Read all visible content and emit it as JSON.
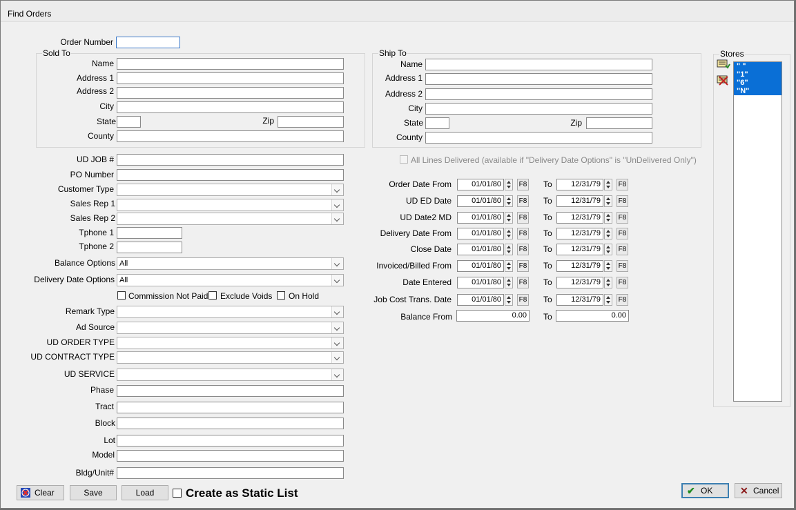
{
  "window": {
    "title": "Find Orders"
  },
  "order_number": {
    "label": "Order Number",
    "value": ""
  },
  "sold_to": {
    "title": "Sold To",
    "name_label": "Name",
    "address1_label": "Address 1",
    "address2_label": "Address 2",
    "city_label": "City",
    "state_label": "State",
    "zip_label": "Zip",
    "county_label": "County"
  },
  "ship_to": {
    "title": "Ship To",
    "name_label": "Name",
    "address1_label": "Address 1",
    "address2_label": "Address 2",
    "city_label": "City",
    "state_label": "State",
    "zip_label": "Zip",
    "county_label": "County"
  },
  "stores": {
    "title": "Stores",
    "items": [
      "\" \"",
      "\"1\"",
      "\"6\"",
      "\"N\""
    ]
  },
  "fields": {
    "ud_job": "UD JOB #",
    "po_number": "PO Number",
    "customer_type": "Customer Type",
    "sales_rep1": "Sales Rep 1",
    "sales_rep2": "Sales Rep 2",
    "tphone1": "Tphone 1",
    "tphone2": "Tphone 2",
    "balance_options": "Balance Options",
    "balance_options_value": "All",
    "delivery_date_options": "Delivery Date Options",
    "delivery_date_options_value": "All",
    "remark_type": "Remark Type",
    "ad_source": "Ad Source",
    "ud_order_type": "UD ORDER TYPE",
    "ud_contract_type": "UD CONTRACT TYPE",
    "ud_service": "UD SERVICE",
    "phase": "Phase",
    "tract": "Tract",
    "block": "Block",
    "lot": "Lot",
    "model": "Model",
    "bldg_unit": "Bldg/Unit#"
  },
  "checks": {
    "commission": "Commission Not Paid",
    "exclude_voids": "Exclude Voids",
    "on_hold": "On Hold"
  },
  "all_lines": "All Lines Delivered (available if \"Delivery Date Options\" is \"UnDelivered Only\")",
  "dates": {
    "to_label": "To",
    "f8": "F8",
    "rows": [
      {
        "label": "Order Date From",
        "from": "01/01/80",
        "to": "12/31/79"
      },
      {
        "label": "UD ED Date",
        "from": "01/01/80",
        "to": "12/31/79"
      },
      {
        "label": "UD Date2 MD",
        "from": "01/01/80",
        "to": "12/31/79"
      },
      {
        "label": "Delivery Date From",
        "from": "01/01/80",
        "to": "12/31/79"
      },
      {
        "label": "Close Date",
        "from": "01/01/80",
        "to": "12/31/79"
      },
      {
        "label": "Invoiced/Billed From",
        "from": "01/01/80",
        "to": "12/31/79"
      },
      {
        "label": "Date Entered",
        "from": "01/01/80",
        "to": "12/31/79"
      },
      {
        "label": "Job Cost Trans. Date",
        "from": "01/01/80",
        "to": "12/31/79"
      }
    ],
    "balance_label": "Balance From",
    "balance_from": "0.00",
    "balance_to": "0.00"
  },
  "buttons": {
    "clear": "Clear",
    "save": "Save",
    "load": "Load",
    "static_list": "Create as Static List",
    "ok": "OK",
    "cancel": "Cancel"
  }
}
